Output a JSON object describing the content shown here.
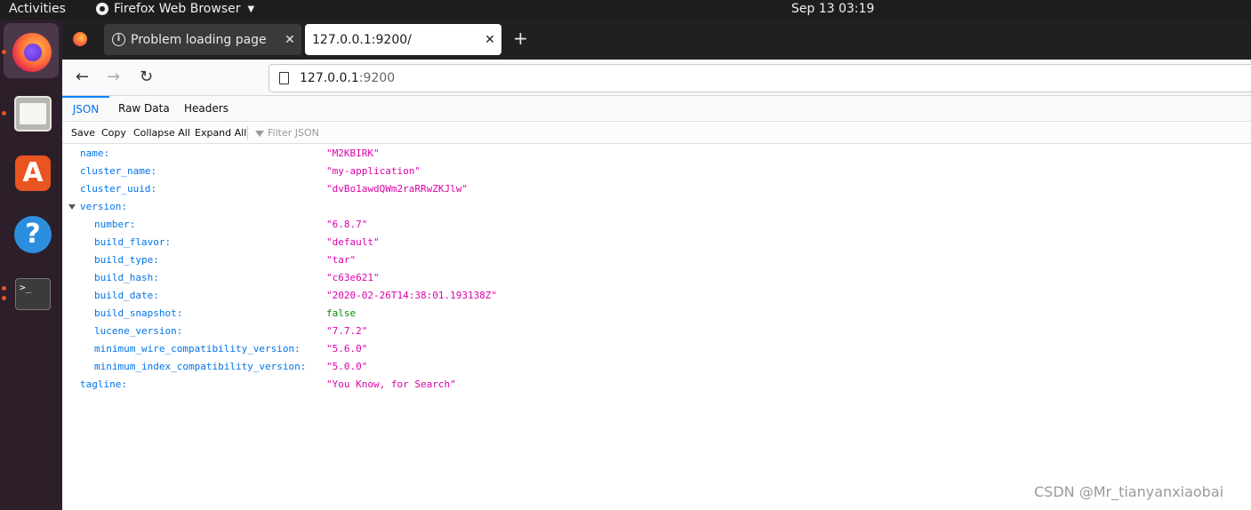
{
  "topbar": {
    "activities": "Activities",
    "app_name": "Firefox Web Browser",
    "clock": "Sep 13  03:19"
  },
  "dock": {
    "items": [
      {
        "name": "Firefox",
        "icon": "firefox-icon"
      },
      {
        "name": "Files",
        "icon": "files-icon"
      },
      {
        "name": "Ubuntu Software",
        "icon": "software-store-icon"
      },
      {
        "name": "Help",
        "icon": "help-icon"
      },
      {
        "name": "Terminal",
        "icon": "terminal-icon"
      }
    ]
  },
  "tabs": [
    {
      "title": "Problem loading page",
      "icon": "info-icon",
      "active": false
    },
    {
      "title": "127.0.0.1:9200/",
      "active": true
    }
  ],
  "nav": {
    "url_host": "127.0.0.1",
    "url_port": ":9200"
  },
  "viewer": {
    "tabs": [
      "JSON",
      "Raw Data",
      "Headers"
    ],
    "actions": {
      "save": "Save",
      "copy": "Copy",
      "collapse": "Collapse All",
      "expand": "Expand All",
      "filter_placeholder": "Filter JSON"
    }
  },
  "json_rows": [
    {
      "key": "name:",
      "value": "\"M2KBIRK\""
    },
    {
      "key": "cluster_name:",
      "value": "\"my-application\""
    },
    {
      "key": "cluster_uuid:",
      "value": "\"dvBo1awdQWm2raRRwZKJlw\""
    },
    {
      "key": "version:",
      "value": ""
    },
    {
      "key": "number:",
      "value": "\"6.8.7\""
    },
    {
      "key": "build_flavor:",
      "value": "\"default\""
    },
    {
      "key": "build_type:",
      "value": "\"tar\""
    },
    {
      "key": "build_hash:",
      "value": "\"c63e621\""
    },
    {
      "key": "build_date:",
      "value": "\"2020-02-26T14:38:01.193138Z\""
    },
    {
      "key": "build_snapshot:",
      "value": "false"
    },
    {
      "key": "lucene_version:",
      "value": "\"7.7.2\""
    },
    {
      "key": "minimum_wire_compatibility_version:",
      "value": "\"5.6.0\""
    },
    {
      "key": "minimum_index_compatibility_version:",
      "value": "\"5.0.0\""
    },
    {
      "key": "tagline:",
      "value": "\"You Know, for Search\""
    }
  ],
  "watermark": "CSDN @Mr_tianyanxiaobai",
  "colors": {
    "json_key": "#0074e8",
    "json_string": "#dd00a9",
    "json_boolean": "#058b00",
    "dock_background": "#2c1f2a",
    "accent_orange": "#e95420"
  }
}
